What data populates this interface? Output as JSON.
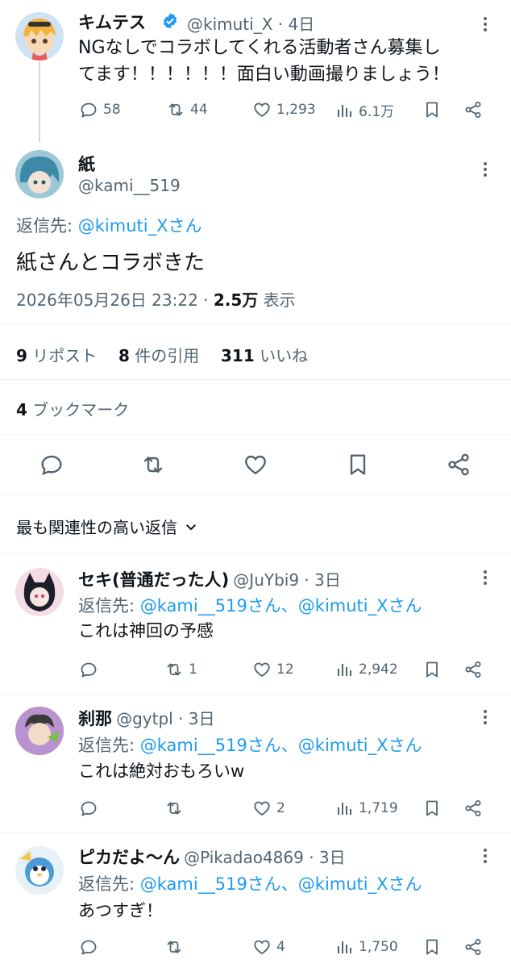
{
  "colors": {
    "accent": "#1d9bf0",
    "text": "#0f1419",
    "muted": "#536471",
    "divider": "#eff3f4"
  },
  "parent": {
    "name": "キムテス",
    "handle": "@kimuti_X",
    "time": "4日",
    "verified": true,
    "text_line1": "NGなしでコラボしてくれる活動者さん募集し",
    "text_line2": "てます！！！！！！面白い動画撮りましょう！",
    "replies": "58",
    "reposts": "44",
    "likes": "1,293",
    "views": "6.1万"
  },
  "main": {
    "name": "紙",
    "handle": "@kami__519",
    "reply_prefix": "返信先:",
    "reply_to": "@kimuti_Xさん",
    "text": "紙さんとコラボきた",
    "timestamp": "2026年05月26日 23:22 · ",
    "views_num": "2.5万",
    "views_label": "表示",
    "reposts_num": "9",
    "reposts_label": "リポスト",
    "quotes_num": "8",
    "quotes_label": "件の引用",
    "likes_num": "311",
    "likes_label": "いいね",
    "bookmarks_num": "4",
    "bookmarks_label": "ブックマーク"
  },
  "sort_label": "最も関連性の高い返信",
  "replies": [
    {
      "name": "セキ(普通だった人)",
      "handle": "@JuYbi9",
      "time": "3日",
      "reply_prefix": "返信先:",
      "reply_to": "@kami__519さん、@kimuti_Xさん",
      "text": "これは神回の予感",
      "replies": "",
      "reposts": "1",
      "likes": "12",
      "views": "2,942"
    },
    {
      "name": "刹那",
      "handle": "@gytpl",
      "time": "3日",
      "reply_prefix": "返信先:",
      "reply_to": "@kami__519さん、@kimuti_Xさん",
      "text": "これは絶対おもろいw",
      "replies": "",
      "reposts": "",
      "likes": "2",
      "views": "1,719"
    },
    {
      "name": "ピカだよ〜ん",
      "handle": "@Pikadao4869",
      "time": "3日",
      "reply_prefix": "返信先:",
      "reply_to": "@kami__519さん、@kimuti_Xさん",
      "text": "あつすぎ！",
      "replies": "",
      "reposts": "",
      "likes": "4",
      "views": "1,750"
    }
  ]
}
